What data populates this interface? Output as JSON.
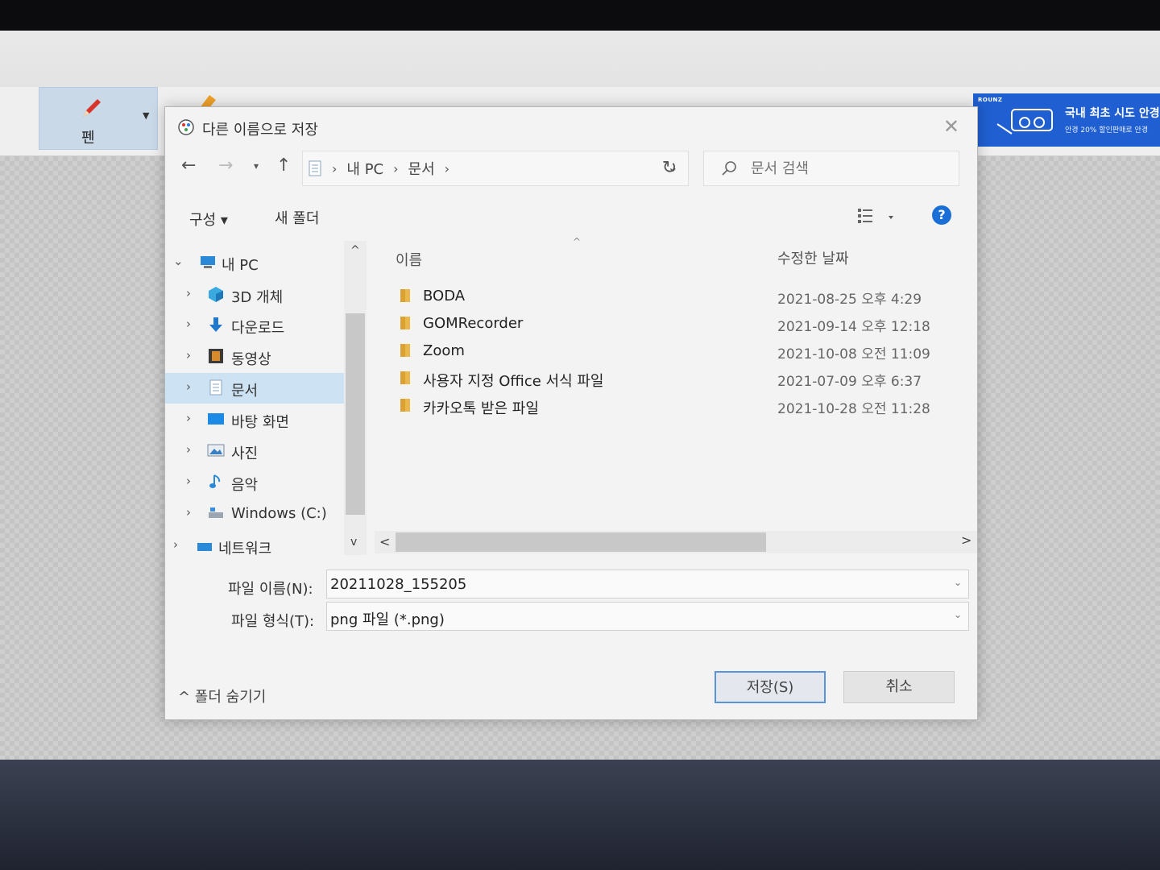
{
  "toolbar": {
    "pen_label": "펜",
    "ad": {
      "brand": "ROUNZ",
      "title": "국내 최초 시도 안경",
      "subtitle": "안경 20% 할인판매로 안경"
    }
  },
  "dialog": {
    "title": "다른 이름으로 저장",
    "address": {
      "crumbs": [
        "내 PC",
        "문서"
      ]
    },
    "search": {
      "placeholder": "문서 검색"
    },
    "commands": {
      "organize": "구성 ▾",
      "new_folder": "새 폴더"
    },
    "nav_tree": [
      {
        "label": "내 PC",
        "icon": "pc-icon",
        "expanded": true
      },
      {
        "label": "3D 개체",
        "icon": "3d-objects-icon"
      },
      {
        "label": "다운로드",
        "icon": "download-icon"
      },
      {
        "label": "동영상",
        "icon": "video-icon"
      },
      {
        "label": "문서",
        "icon": "document-icon",
        "selected": true
      },
      {
        "label": "바탕 화면",
        "icon": "desktop-icon"
      },
      {
        "label": "사진",
        "icon": "pictures-icon"
      },
      {
        "label": "음악",
        "icon": "music-icon"
      },
      {
        "label": "Windows (C:)",
        "icon": "drive-icon"
      },
      {
        "label": "네트워크",
        "icon": "network-icon"
      }
    ],
    "columns": {
      "name": "이름",
      "date": "수정한 날짜"
    },
    "files": [
      {
        "name": "BODA",
        "date": "2021-08-25 오후 4:29"
      },
      {
        "name": "GOMRecorder",
        "date": "2021-09-14 오후 12:18"
      },
      {
        "name": "Zoom",
        "date": "2021-10-08 오전 11:09"
      },
      {
        "name": "사용자 지정 Office 서식 파일",
        "date": "2021-07-09 오후 6:37"
      },
      {
        "name": "카카오톡 받은 파일",
        "date": "2021-10-28 오전 11:28"
      }
    ],
    "filename": {
      "label": "파일 이름(N):",
      "value": "20211028_155205"
    },
    "filetype": {
      "label": "파일 형식(T):",
      "value": "png 파일 (*.png)"
    },
    "hide_folders": "^ 폴더 숨기기",
    "save_button": "저장(S)",
    "cancel_button": "취소"
  },
  "colors": {
    "accent": "#1a6fd6",
    "selection": "#cde3f3",
    "folder": "#e8b84a",
    "ad_background": "#1f5fd1"
  }
}
